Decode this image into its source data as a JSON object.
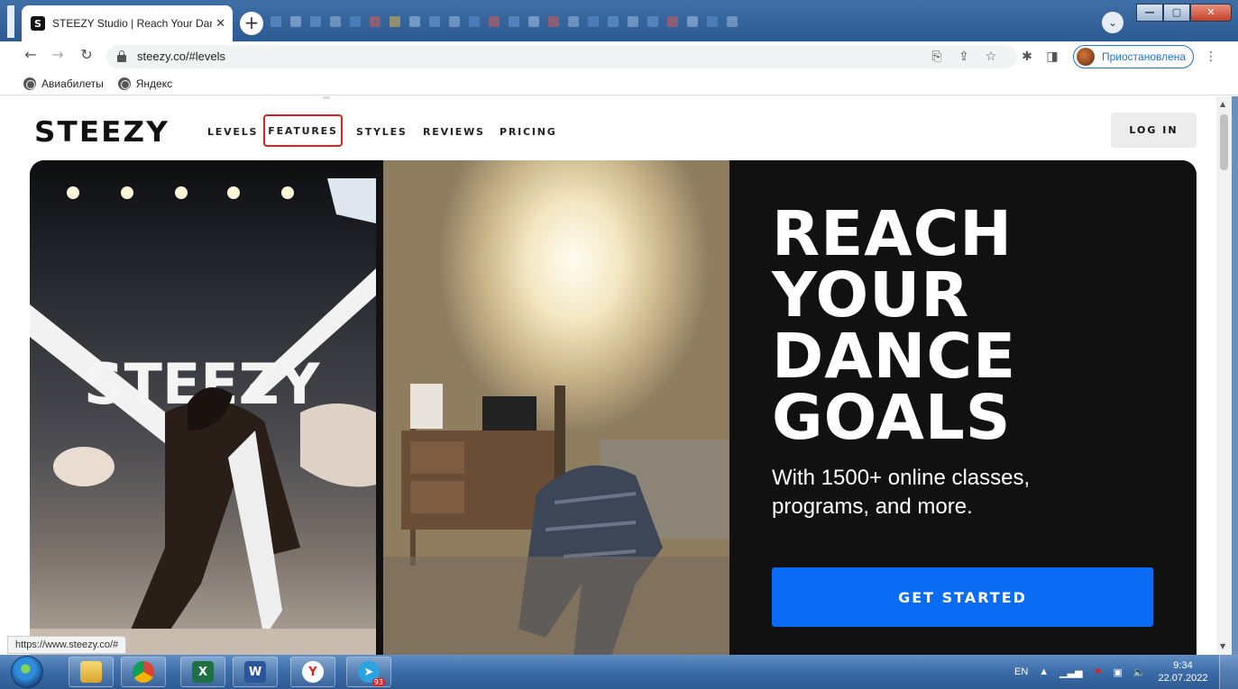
{
  "browser": {
    "tab_favicon": "S",
    "tab_title": "STEEZY Studio | Reach Your Danc",
    "tab_close": "✕",
    "new_tab": "+",
    "tab_search": "⌄",
    "win_min": "—",
    "win_max": "▢",
    "win_close": "✕",
    "url": "steezy.co/#levels",
    "profile_label": "Приостановлена",
    "bookmarks": [
      {
        "label": "Авиабилеты",
        "icon": "globe-icon"
      },
      {
        "label": "Яндекс",
        "icon": "globe-icon"
      }
    ],
    "status_url": "https://www.steezy.co/#"
  },
  "site": {
    "logo": "STEEZY",
    "nav": {
      "levels": "LEVELS",
      "features": "FEATURES",
      "styles": "STYLES",
      "reviews": "REVIEWS",
      "pricing": "PRICING"
    },
    "login": "LOG IN",
    "hero": {
      "headline_lines": [
        "REACH",
        "YOUR",
        "DANCE",
        "GOALS"
      ],
      "subtitle": "With 1500+ online classes, programs, and more.",
      "cta": "GET STARTED",
      "left_video_sign": "STEEZY"
    }
  },
  "taskbar": {
    "apps": [
      "explorer",
      "chrome",
      "excel",
      "word",
      "yandex",
      "telegram"
    ],
    "telegram_badge": "93",
    "language": "EN",
    "time": "9:34",
    "date": "22.07.2022"
  },
  "colors": {
    "accent_blue": "#0a6cf5",
    "highlight_red": "#e0201f",
    "hero_panel": "#111111"
  }
}
